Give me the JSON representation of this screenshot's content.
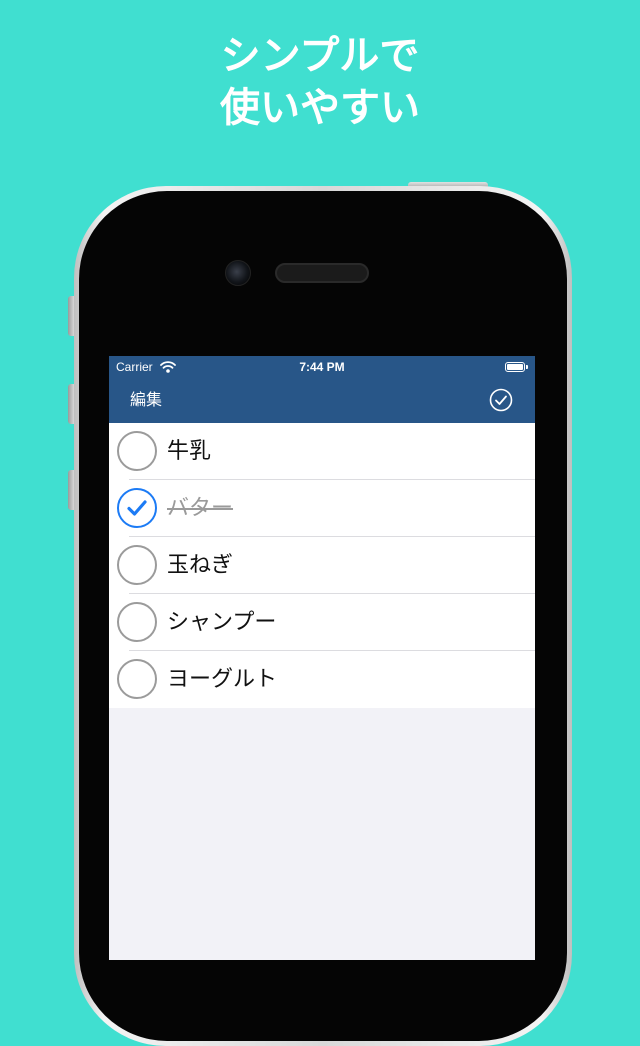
{
  "promo": {
    "line1": "シンプルで",
    "line2": "使いやすい",
    "background_color": "#40DFD0"
  },
  "status_bar": {
    "carrier": "Carrier",
    "time": "7:44 PM"
  },
  "nav": {
    "edit_label": "編集",
    "bar_color": "#285688"
  },
  "items": [
    {
      "label": "牛乳",
      "checked": false
    },
    {
      "label": "バター",
      "checked": true
    },
    {
      "label": "玉ねぎ",
      "checked": false
    },
    {
      "label": "シャンプー",
      "checked": false
    },
    {
      "label": "ヨーグルト",
      "checked": false
    }
  ],
  "colors": {
    "check_accent": "#1C7BF5",
    "list_background": "#F2F2F7"
  }
}
